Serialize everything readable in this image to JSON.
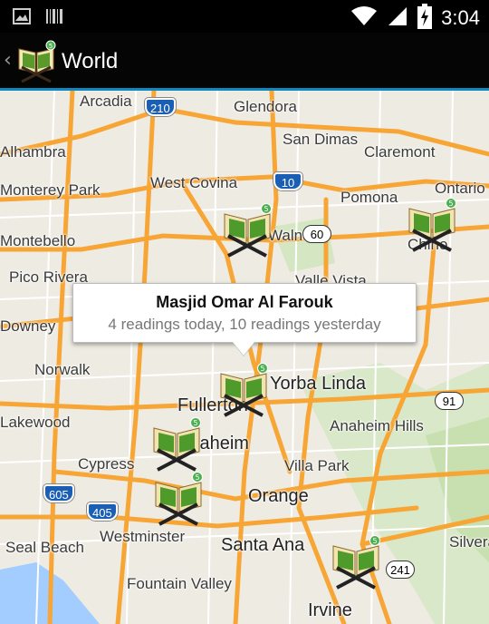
{
  "status_bar": {
    "time": "3:04",
    "icons": [
      "image-icon",
      "barcode-icon",
      "wifi-icon",
      "signal-icon",
      "battery-charging-icon"
    ]
  },
  "action_bar": {
    "up_caret": "‹",
    "title": "World",
    "logo": "quran-book-icon",
    "badge": "5"
  },
  "map": {
    "cities": [
      "Arcadia",
      "Glendora",
      "Alhambra",
      "San Dimas",
      "Claremont",
      "West Covina",
      "Monterey Park",
      "Pomona",
      "Ontario",
      "Montebello",
      "Pico Rivera",
      "Downey",
      "Norwalk",
      "Yorba Linda",
      "Fullerton",
      "Lakewood",
      "Anaheim Hills",
      "Anaheim",
      "Cypress",
      "Villa Park",
      "Orange",
      "Westminster",
      "Seal Beach",
      "Santa Ana",
      "Silverado",
      "Fountain Valley",
      "Irvine",
      "Walnut",
      "Valle Vista",
      "Chino"
    ],
    "highway_shields": [
      "210",
      "10",
      "60",
      "605",
      "405",
      "91",
      "241"
    ],
    "marker_badge": "5",
    "colors": {
      "land": "#eeebe2",
      "highway": "#f7a535",
      "water": "#a3ccff",
      "park": "#cce3b8",
      "accent": "#0e8ac0"
    }
  },
  "info_window": {
    "title": "Masjid Omar Al Farouk",
    "subtitle": "4 readings today, 10 readings yesterday"
  }
}
